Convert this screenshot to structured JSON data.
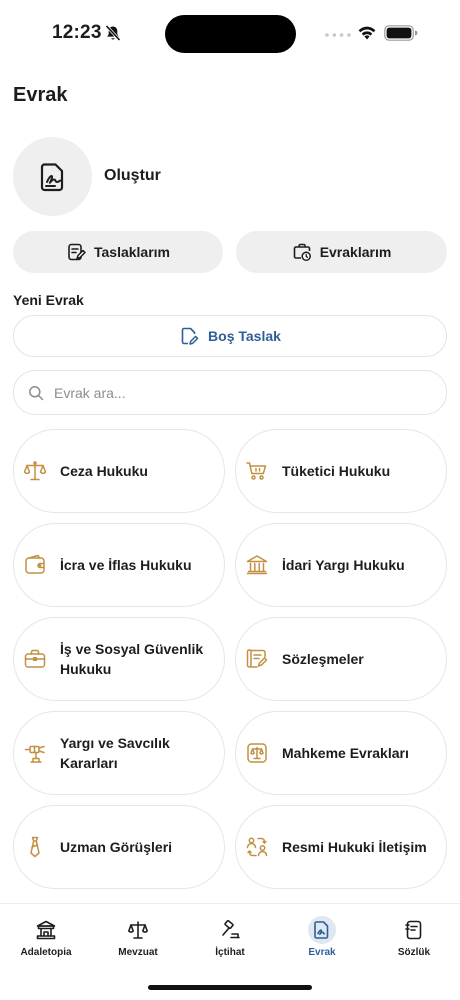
{
  "status_bar": {
    "time": "12:23"
  },
  "page": {
    "title": "Evrak"
  },
  "create": {
    "label": "Oluştur"
  },
  "actions": {
    "drafts": "Taslaklarım",
    "documents": "Evraklarım"
  },
  "new_document": {
    "section_label": "Yeni Evrak",
    "blank_draft": "Boş Taslak"
  },
  "search": {
    "placeholder": "Evrak ara..."
  },
  "categories": [
    {
      "label": "Ceza Hukuku",
      "icon": "scales-icon"
    },
    {
      "label": "Tüketici Hukuku",
      "icon": "cart-icon"
    },
    {
      "label": "İcra ve İflas Hukuku",
      "icon": "wallet-icon"
    },
    {
      "label": "İdari Yargı Hukuku",
      "icon": "building-icon"
    },
    {
      "label": "İş ve Sosyal Güvenlik Hukuku",
      "icon": "briefcase-icon"
    },
    {
      "label": "Sözleşmeler",
      "icon": "contract-icon"
    },
    {
      "label": "Yargı ve Savcılık Kararları",
      "icon": "gavel-icon"
    },
    {
      "label": "Mahkeme Evrakları",
      "icon": "court-document-icon"
    },
    {
      "label": "Uzman Görüşleri",
      "icon": "tie-icon"
    },
    {
      "label": "Resmi Hukuki İletişim",
      "icon": "communication-icon"
    }
  ],
  "tabs": [
    {
      "label": "Adaletopia",
      "icon": "temple-icon"
    },
    {
      "label": "Mevzuat",
      "icon": "scales-icon"
    },
    {
      "label": "İçtihat",
      "icon": "gavel-icon"
    },
    {
      "label": "Evrak",
      "icon": "document-sign-icon",
      "active": true
    },
    {
      "label": "Sözlük",
      "icon": "dictionary-icon"
    }
  ],
  "colors": {
    "accent": "#2f5f96",
    "icon_gold": "#c29043",
    "surface": "#efefef"
  }
}
